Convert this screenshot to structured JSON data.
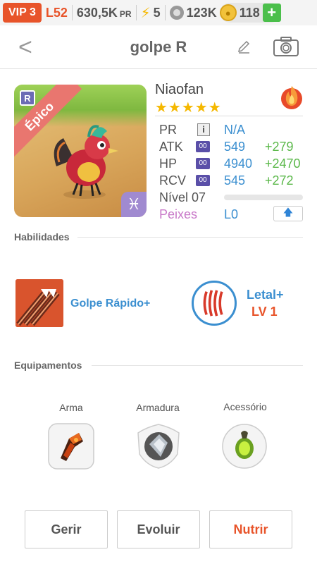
{
  "status_bar": {
    "vip": "VIP 3",
    "level": "L52",
    "power": "630,5K",
    "power_unit": "PR",
    "energy": "5",
    "food": "123K",
    "gold": "118"
  },
  "header": {
    "title": "golpe R"
  },
  "pet": {
    "name": "Niaofan",
    "rarity": "Épico",
    "stars": "★★★★★",
    "stats": {
      "pr": {
        "label": "PR",
        "value": "N/A"
      },
      "atk": {
        "label": "ATK",
        "chip": "00",
        "value": "549",
        "bonus": "+279"
      },
      "hp": {
        "label": "HP",
        "chip": "00",
        "value": "4940",
        "bonus": "+2470"
      },
      "rcv": {
        "label": "RCV",
        "chip": "00",
        "value": "545",
        "bonus": "+272"
      },
      "level": {
        "label": "Nível 07"
      },
      "fish": {
        "label": "Peixes",
        "value": "L0"
      }
    }
  },
  "skills": {
    "section_label": "Habilidades",
    "active": {
      "name": "Golpe Rápido+"
    },
    "passive": {
      "name": "Letal+",
      "level": "LV 1"
    }
  },
  "equipment": {
    "section_label": "Equipamentos",
    "slots": [
      {
        "label": "Arma"
      },
      {
        "label": "Armadura"
      },
      {
        "label": "Acessório"
      }
    ]
  },
  "actions": {
    "manage": "Gerir",
    "evolve": "Evoluir",
    "feed": "Nutrir"
  },
  "colors": {
    "accent": "#e8542a",
    "stat_value": "#3b8fd0",
    "stat_bonus": "#5bb84a",
    "gold": "#f2c23a"
  }
}
